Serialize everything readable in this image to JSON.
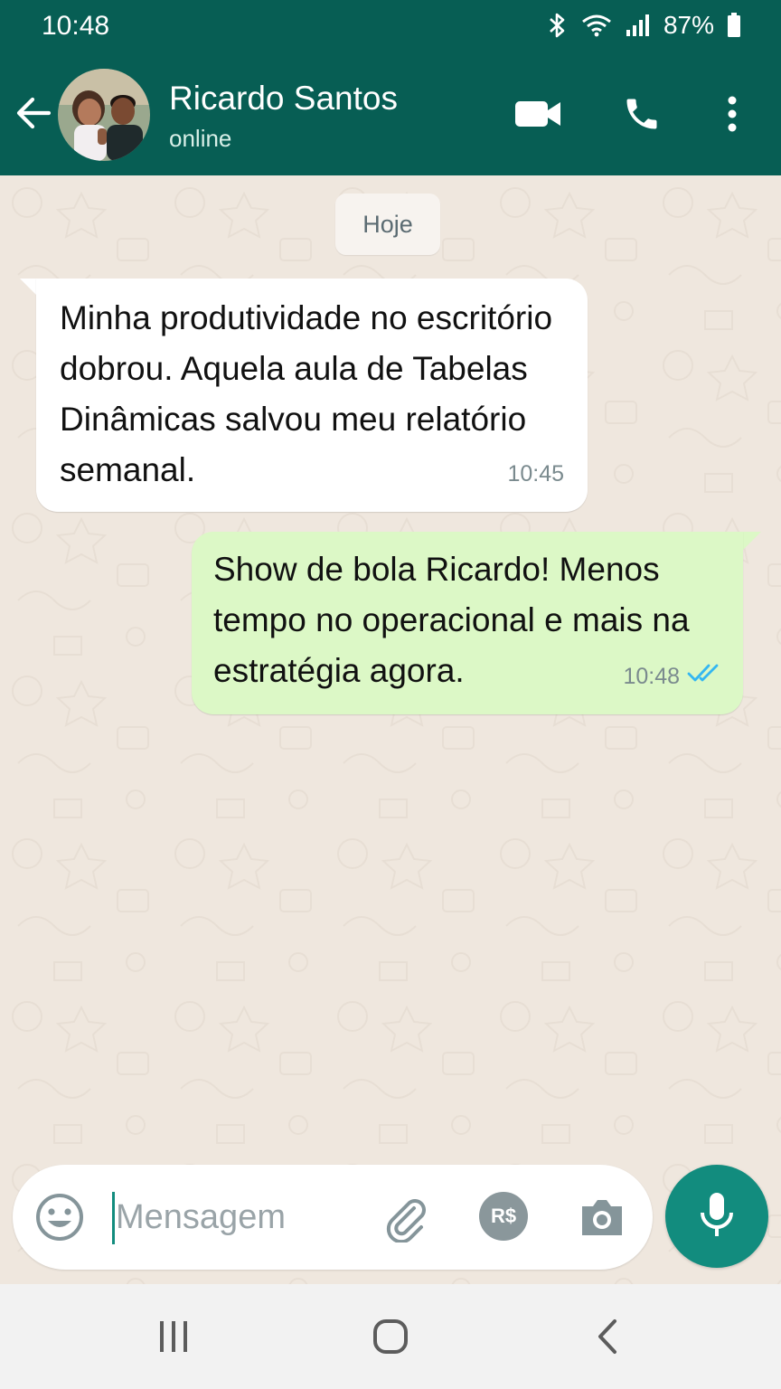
{
  "status_bar": {
    "time": "10:48",
    "battery_percent": "87%",
    "icons": [
      "bluetooth-icon",
      "wifi-icon",
      "signal-icon",
      "battery-icon"
    ]
  },
  "header": {
    "contact_name": "Ricardo Santos",
    "contact_status": "online",
    "icons": [
      "back-arrow-icon",
      "video-call-icon",
      "phone-icon",
      "more-vert-icon"
    ],
    "background_color": "#075e54"
  },
  "chat": {
    "date_chip": "Hoje",
    "messages": [
      {
        "direction": "incoming",
        "text": "Minha produtividade no escritório dobrou. Aquela aula de Tabelas Dinâmicas salvou meu relatório semanal.",
        "time": "10:45"
      },
      {
        "direction": "outgoing",
        "text": "Show de bola Ricardo! Menos tempo no operacional e mais na estratégia agora.",
        "time": "10:48",
        "status": "read"
      }
    ],
    "incoming_bubble_color": "#ffffff",
    "outgoing_bubble_color": "#dcf8c6",
    "read_tick_color": "#34b7f1"
  },
  "composer": {
    "placeholder": "Mensagem",
    "value": "",
    "pay_label": "R$",
    "icons": [
      "emoji-icon",
      "attach-icon",
      "payment-icon",
      "camera-icon",
      "mic-icon"
    ],
    "mic_button_color": "#128c7e"
  },
  "navigation": {
    "buttons": [
      "recents-icon",
      "home-icon",
      "back-icon"
    ]
  }
}
